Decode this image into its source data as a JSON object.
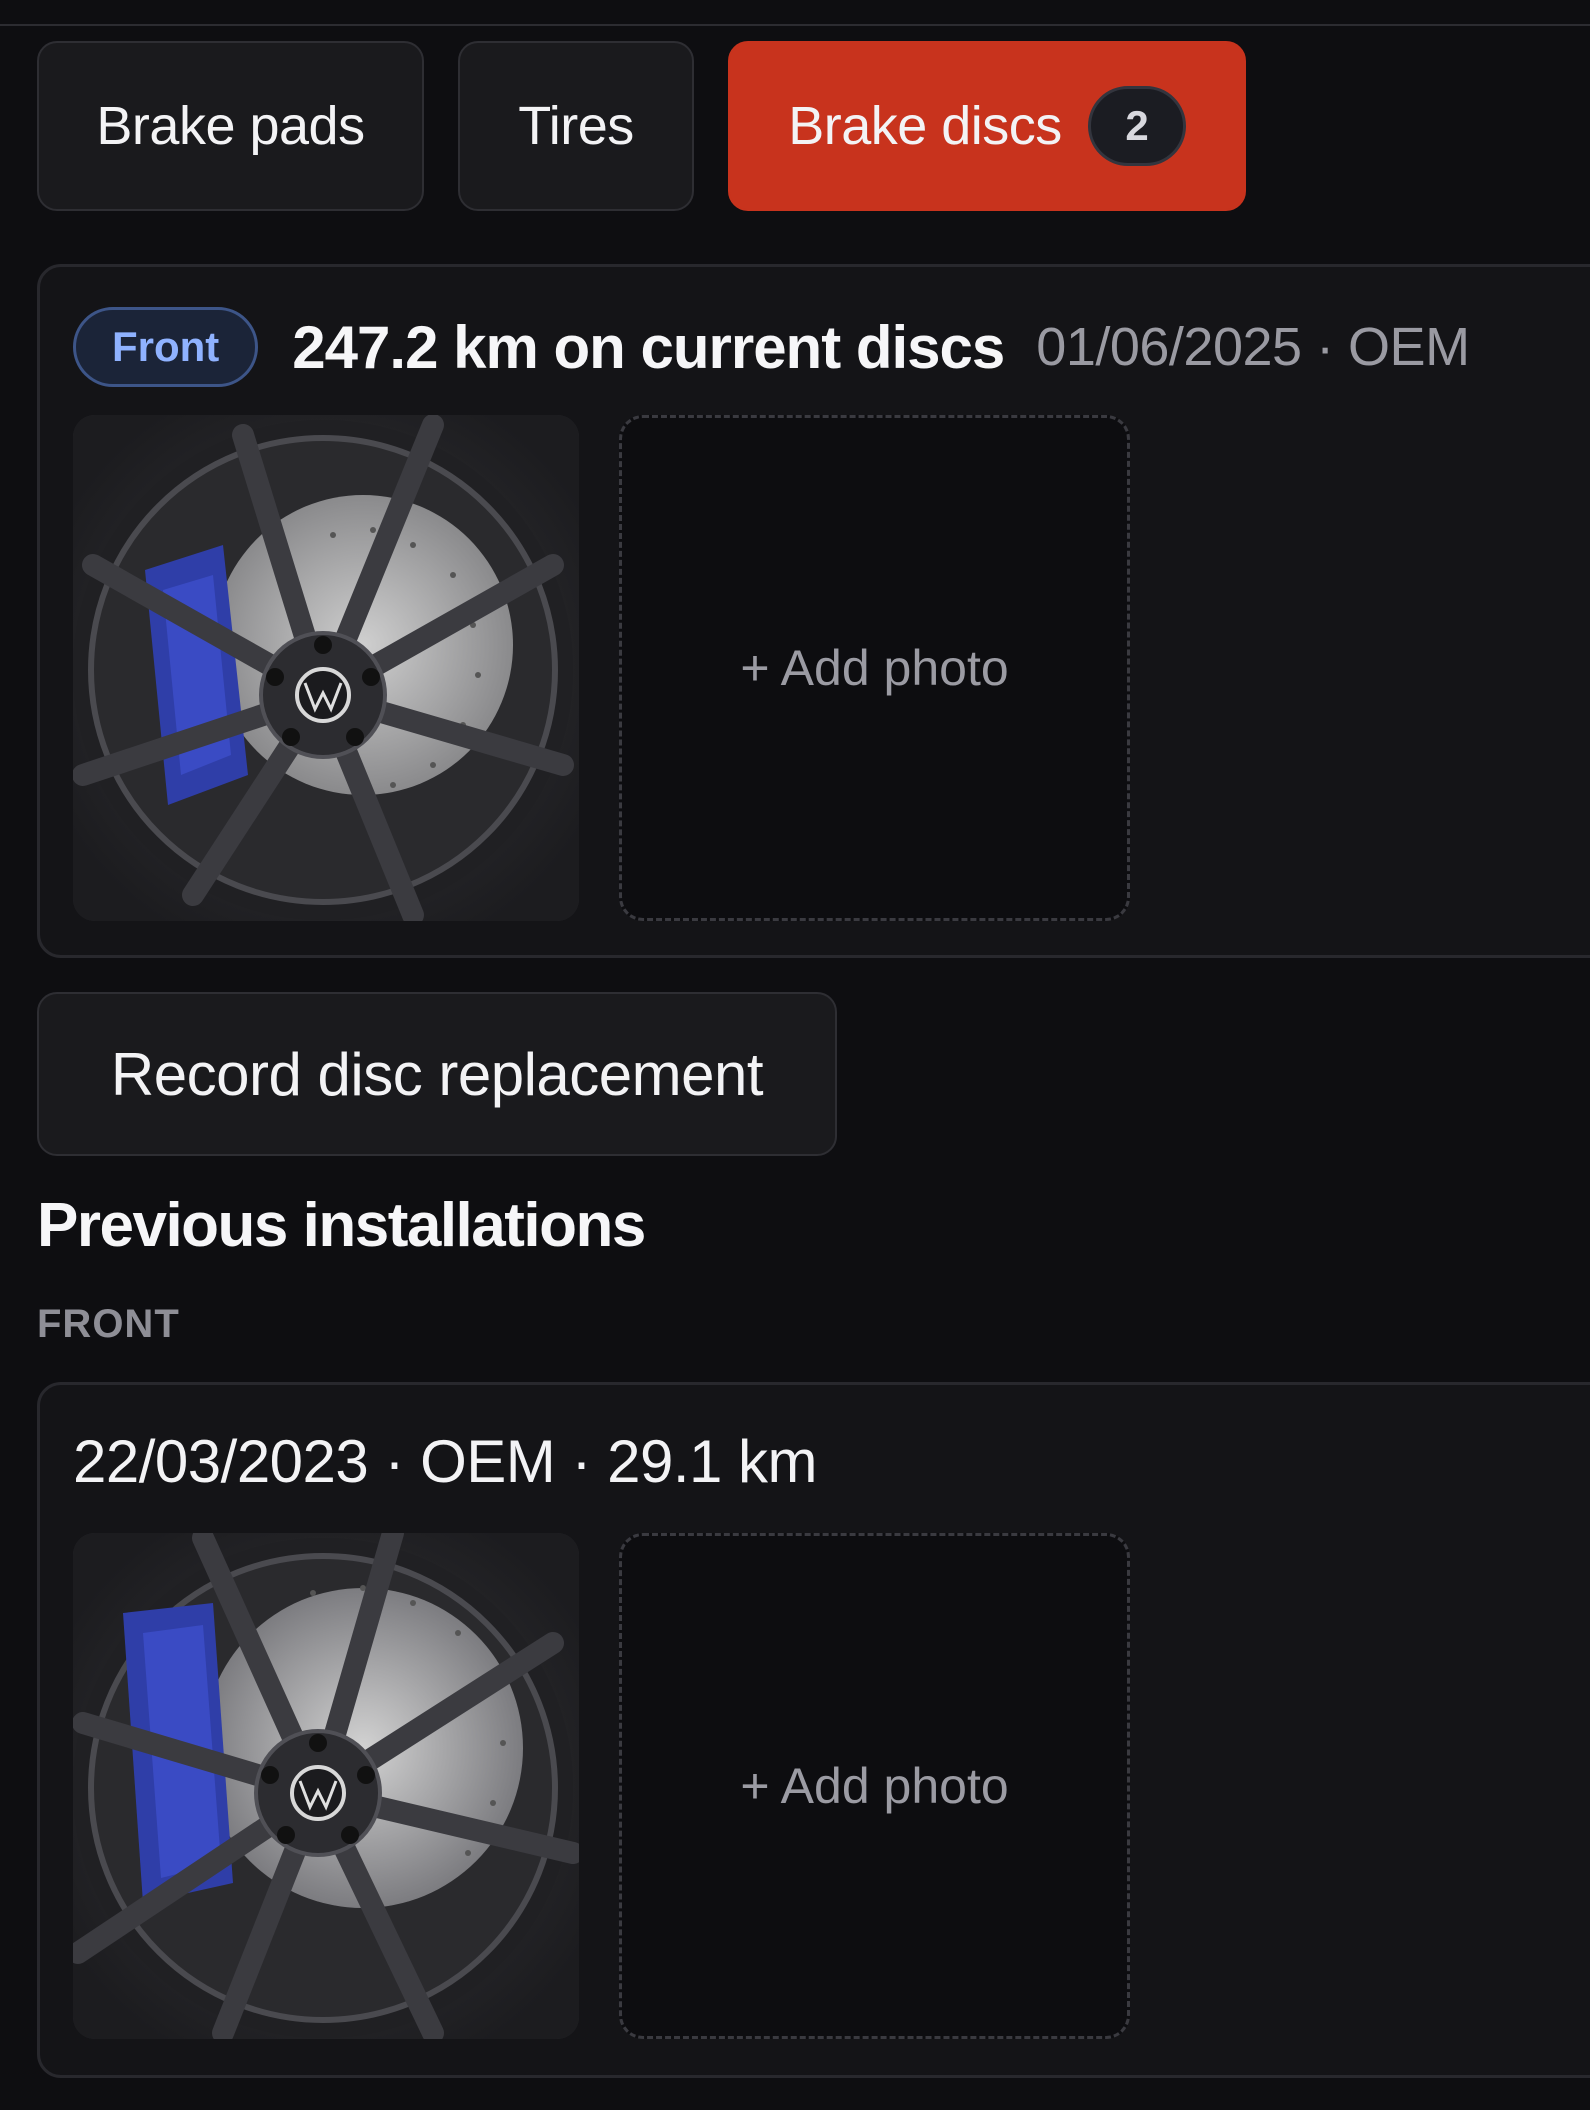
{
  "tabs": [
    {
      "label": "Brake pads",
      "active": false
    },
    {
      "label": "Tires",
      "active": false
    },
    {
      "label": "Brake discs",
      "active": true,
      "badge": "2"
    }
  ],
  "current": {
    "position": "Front",
    "km_title": "247.2 km on current discs",
    "meta": "01/06/2025 · OEM",
    "photo_icon": "wheel-photo",
    "add_photo_label": "+ Add photo"
  },
  "record_button": "Record disc replacement",
  "previous": {
    "section_title": "Previous installations",
    "group_label": "FRONT",
    "items": [
      {
        "title": "22/03/2023 · OEM · 29.1 km",
        "photo_icon": "wheel-photo",
        "add_photo_label": "+ Add photo"
      }
    ]
  },
  "colors": {
    "background": "#0e0e11",
    "accent": "#c8331d",
    "card": "#141417",
    "front_badge": "#8fb2ff"
  }
}
